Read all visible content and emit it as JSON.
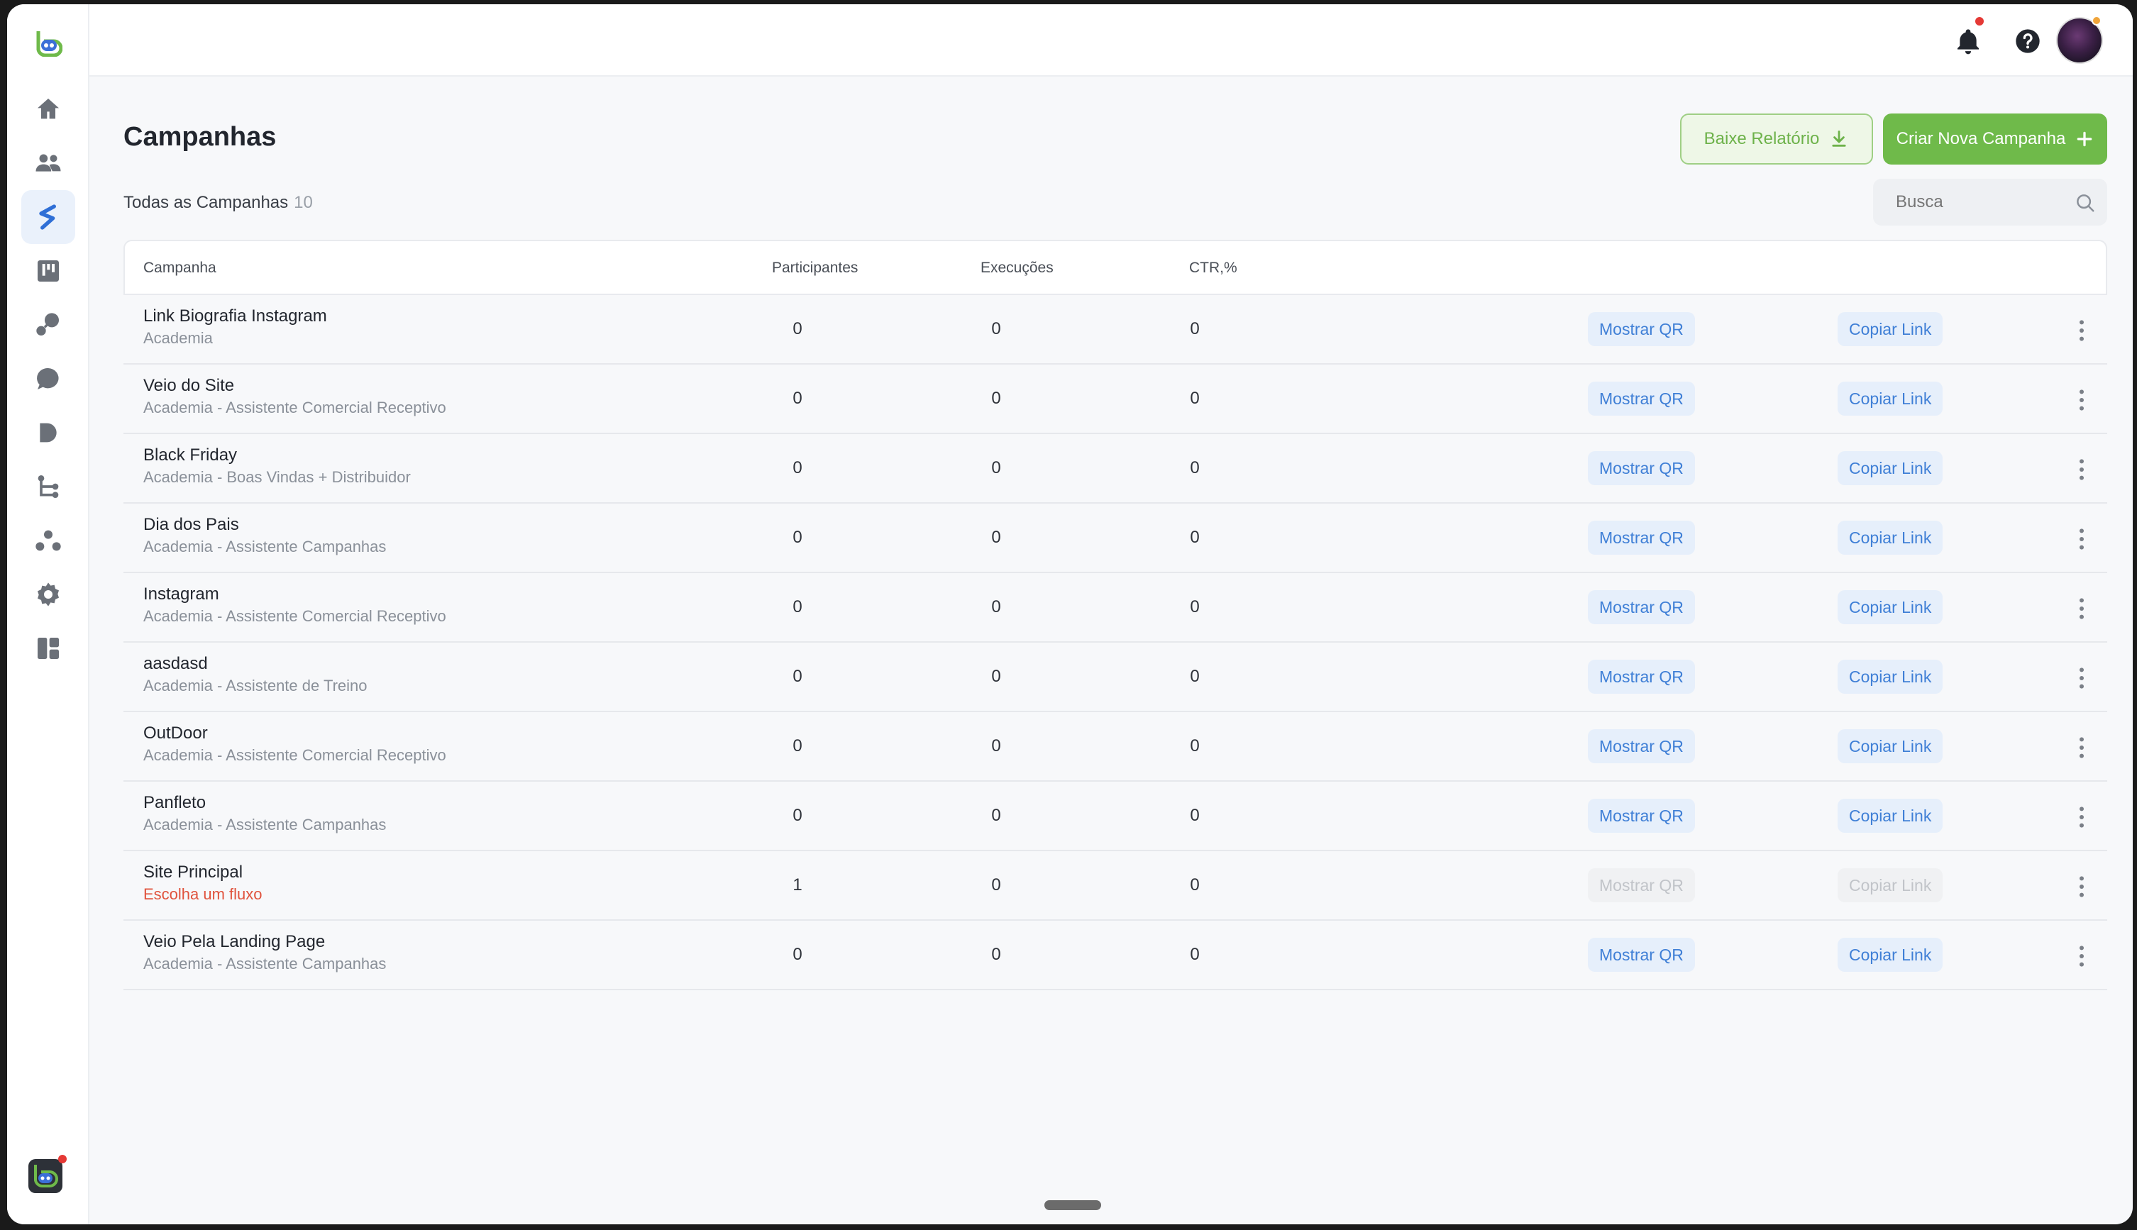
{
  "sidebar": {
    "nav": [
      {
        "icon": "home-icon"
      },
      {
        "icon": "people-icon"
      },
      {
        "icon": "campaign-icon",
        "active": true
      },
      {
        "icon": "board-icon"
      },
      {
        "icon": "integration-icon"
      },
      {
        "icon": "chat-icon"
      },
      {
        "icon": "play-icon"
      },
      {
        "icon": "flow-icon"
      },
      {
        "icon": "network-icon"
      },
      {
        "icon": "gear-icon"
      },
      {
        "icon": "dashboard-icon"
      }
    ]
  },
  "page": {
    "title": "Campanhas",
    "subtitle": "Todas as Campanhas",
    "count": "10",
    "report_button": "Baixe Relatório",
    "create_button": "Criar Nova Campanha",
    "search_placeholder": "Busca"
  },
  "table": {
    "columns": [
      "Campanha",
      "Participantes",
      "Execuções",
      "CTR,%"
    ],
    "show_qr_label": "Mostrar QR",
    "copy_link_label": "Copiar Link",
    "rows": [
      {
        "name": "Link Biografia Instagram",
        "subtitle": "Academia",
        "participants": "0",
        "executions": "0",
        "ctr": "0",
        "enabled": true
      },
      {
        "name": "Veio do Site",
        "subtitle": "Academia - Assistente Comercial Receptivo",
        "participants": "0",
        "executions": "0",
        "ctr": "0",
        "enabled": true
      },
      {
        "name": "Black Friday",
        "subtitle": "Academia - Boas Vindas + Distribuidor",
        "participants": "0",
        "executions": "0",
        "ctr": "0",
        "enabled": true
      },
      {
        "name": "Dia dos Pais",
        "subtitle": "Academia - Assistente Campanhas",
        "participants": "0",
        "executions": "0",
        "ctr": "0",
        "enabled": true
      },
      {
        "name": "Instagram",
        "subtitle": "Academia - Assistente Comercial Receptivo",
        "participants": "0",
        "executions": "0",
        "ctr": "0",
        "enabled": true
      },
      {
        "name": "aasdasd",
        "subtitle": "Academia - Assistente de Treino",
        "participants": "0",
        "executions": "0",
        "ctr": "0",
        "enabled": true
      },
      {
        "name": "OutDoor",
        "subtitle": "Academia - Assistente Comercial Receptivo",
        "participants": "0",
        "executions": "0",
        "ctr": "0",
        "enabled": true
      },
      {
        "name": "Panfleto",
        "subtitle": "Academia - Assistente Campanhas",
        "participants": "0",
        "executions": "0",
        "ctr": "0",
        "enabled": true
      },
      {
        "name": "Site Principal",
        "subtitle": "Escolha um fluxo",
        "participants": "1",
        "executions": "0",
        "ctr": "0",
        "enabled": false,
        "warning": true
      },
      {
        "name": "Veio Pela Landing Page",
        "subtitle": "Academia - Assistente Campanhas",
        "participants": "0",
        "executions": "0",
        "ctr": "0",
        "enabled": true
      }
    ]
  },
  "colors": {
    "accent_green": "#6fba4a",
    "link_blue": "#3f7fd6",
    "warning_red": "#e0533d"
  }
}
